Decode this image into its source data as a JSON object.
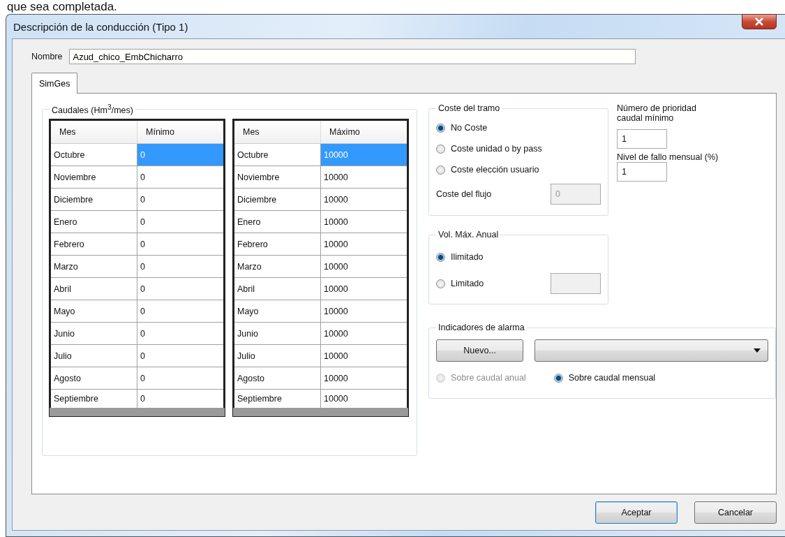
{
  "caption": "que sea completada.",
  "window": {
    "title": "Descripción de la conducción (Tipo 1)"
  },
  "name_field": {
    "label": "Nombre",
    "value": "Azud_chico_EmbChicharro"
  },
  "tabs": [
    {
      "label": "SimGes",
      "selected": true
    }
  ],
  "flows": {
    "title": "Caudales (Hm$^{3}$/mes)",
    "tables": [
      {
        "columns": [
          "Mes",
          "Mínimo"
        ],
        "rows": [
          {
            "month": "Octubre",
            "value": "0",
            "selected": true
          },
          {
            "month": "Noviembre",
            "value": "0",
            "selected": false
          },
          {
            "month": "Diciembre",
            "value": "0",
            "selected": false
          },
          {
            "month": "Enero",
            "value": "0",
            "selected": false
          },
          {
            "month": "Febrero",
            "value": "0",
            "selected": false
          },
          {
            "month": "Marzo",
            "value": "0",
            "selected": false
          },
          {
            "month": "Abril",
            "value": "0",
            "selected": false
          },
          {
            "month": "Mayo",
            "value": "0",
            "selected": false
          },
          {
            "month": "Junio",
            "value": "0",
            "selected": false
          },
          {
            "month": "Julio",
            "value": "0",
            "selected": false
          },
          {
            "month": "Agosto",
            "value": "0",
            "selected": false
          },
          {
            "month": "Septiembre",
            "value": "0",
            "selected": false
          }
        ]
      },
      {
        "columns": [
          "Mes",
          "Máximo"
        ],
        "rows": [
          {
            "month": "Octubre",
            "value": "10000",
            "selected": true
          },
          {
            "month": "Noviembre",
            "value": "10000",
            "selected": false
          },
          {
            "month": "Diciembre",
            "value": "10000",
            "selected": false
          },
          {
            "month": "Enero",
            "value": "10000",
            "selected": false
          },
          {
            "month": "Febrero",
            "value": "10000",
            "selected": false
          },
          {
            "month": "Marzo",
            "value": "10000",
            "selected": false
          },
          {
            "month": "Abril",
            "value": "10000",
            "selected": false
          },
          {
            "month": "Mayo",
            "value": "10000",
            "selected": false
          },
          {
            "month": "Junio",
            "value": "10000",
            "selected": false
          },
          {
            "month": "Julio",
            "value": "10000",
            "selected": false
          },
          {
            "month": "Agosto",
            "value": "10000",
            "selected": false
          },
          {
            "month": "Septiembre",
            "value": "10000",
            "selected": false
          }
        ]
      }
    ]
  },
  "cost": {
    "title": "Coste del tramo",
    "options": [
      {
        "label": "No Coste",
        "selected": true
      },
      {
        "label": "Coste unidad o by pass",
        "selected": false
      },
      {
        "label": "Coste elección usuario",
        "selected": false
      }
    ],
    "flow_cost": {
      "label": "Coste del flujo",
      "value": "0",
      "disabled": true
    }
  },
  "max_volume": {
    "title": "Vol. Máx. Anual",
    "options": [
      {
        "label": "Ilimitado",
        "selected": true,
        "has_field": false
      },
      {
        "label": "Limitado",
        "selected": false,
        "has_field": true
      }
    ]
  },
  "priority": {
    "label": "Número de prioridad caudal mínimo",
    "value": "1"
  },
  "failure": {
    "label": "Nivel de fallo mensual (%)",
    "value": "1"
  },
  "alarms": {
    "title": "Indicadores de alarma",
    "new_button": "Nuevo...",
    "options": [
      {
        "label": "Sobre caudal anual",
        "selected": false,
        "disabled": true
      },
      {
        "label": "Sobre caudal mensual",
        "selected": true,
        "disabled": false
      }
    ]
  },
  "buttons": [
    {
      "label": "Aceptar",
      "default": true
    },
    {
      "label": "Cancelar",
      "default": false
    }
  ]
}
